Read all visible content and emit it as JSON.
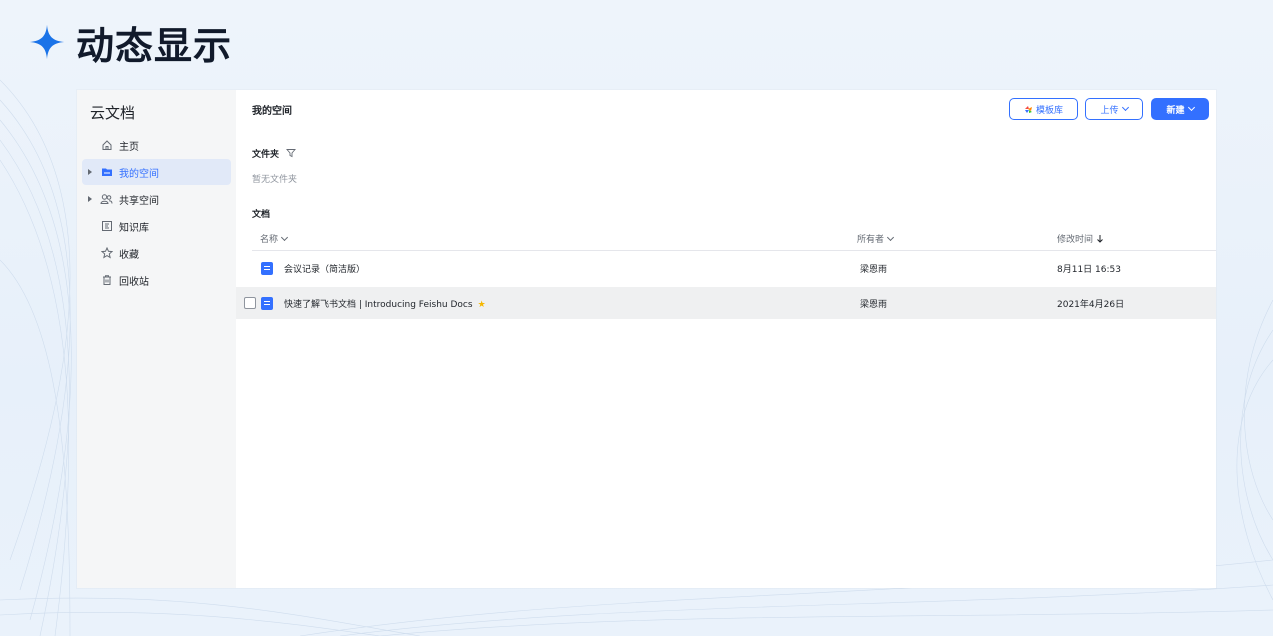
{
  "slide": {
    "title": "动态显示",
    "accent": "#1a73e8"
  },
  "sidebar": {
    "title": "云文档",
    "items": [
      {
        "label": "主页",
        "icon": "home-icon"
      },
      {
        "label": "我的空间",
        "icon": "folder-icon",
        "active": true
      },
      {
        "label": "共享空间",
        "icon": "people-icon"
      },
      {
        "label": "知识库",
        "icon": "book-icon"
      },
      {
        "label": "收藏",
        "icon": "star-icon"
      },
      {
        "label": "回收站",
        "icon": "trash-icon"
      }
    ]
  },
  "main": {
    "title": "我的空间",
    "buttons": {
      "templates": "模板库",
      "upload": "上传",
      "new": "新建"
    },
    "folders": {
      "heading": "文件夹",
      "empty_text": "暂无文件夹"
    },
    "docs": {
      "heading": "文档",
      "columns": {
        "name": "名称",
        "owner": "所有者",
        "modified": "修改时间"
      },
      "rows": [
        {
          "name": "会议记录（简洁版）",
          "owner": "梁恩雨",
          "modified": "8月11日 16:53",
          "starred": false
        },
        {
          "name": "快速了解飞书文档 | Introducing Feishu Docs",
          "owner": "梁恩雨",
          "modified": "2021年4月26日",
          "starred": true
        }
      ]
    }
  },
  "colors": {
    "primary": "#3370ff",
    "sidebar_bg": "#f5f6f7",
    "active_bg": "#e1e9f8",
    "star": "#f5b700"
  }
}
